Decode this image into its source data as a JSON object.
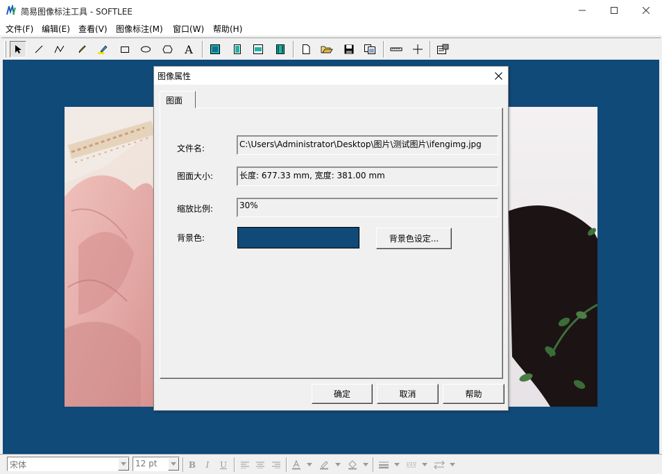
{
  "app": {
    "title": "简易图像标注工具 - SOFTLEE"
  },
  "menu": [
    {
      "label": "文件(F)"
    },
    {
      "label": "编辑(E)"
    },
    {
      "label": "查看(V)"
    },
    {
      "label": "图像标注(M)"
    },
    {
      "label": "窗口(W)"
    },
    {
      "label": "帮助(H)"
    }
  ],
  "toolbar": {
    "text_tool_glyph": "A",
    "tools": [
      "select-icon",
      "line-icon",
      "polyline-icon",
      "pencil-icon",
      "highlighter-icon",
      "rectangle-icon",
      "ellipse-icon",
      "polygon-icon",
      "text-icon",
      "fit-page-icon",
      "fit-width-icon",
      "fit-height-icon",
      "actual-size-icon",
      "new-file-icon",
      "open-folder-icon",
      "save-icon",
      "copy-icon",
      "ruler-icon",
      "crosshair-icon",
      "properties-icon"
    ]
  },
  "canvas": {
    "background": "#0f4a78"
  },
  "dialog": {
    "title": "图像属性",
    "tab": "图面",
    "filename_label": "文件名:",
    "filename_value": "C:\\Users\\Administrator\\Desktop\\图片\\测试图片\\ifengimg.jpg",
    "size_label": "图面大小:",
    "size_value": "长度: 677.33 mm, 宽度: 381.00 mm",
    "zoom_label": "缩放比例:",
    "zoom_value": "30%",
    "bg_label": "背景色:",
    "bg_color": "#0f4a78",
    "bg_button": "背景色设定...",
    "ok": "确定",
    "cancel": "取消",
    "help": "帮助"
  },
  "statusbar": {
    "font": "宋体",
    "size": "12 pt",
    "bold": "B",
    "italic": "I",
    "underline": "U"
  }
}
